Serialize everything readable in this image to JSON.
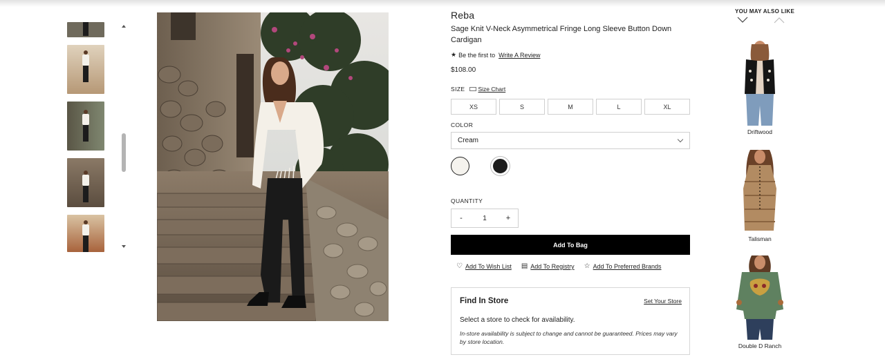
{
  "thumbnails": {
    "items": [
      {
        "label": "thumb-1",
        "bg": "#6f6a5c"
      },
      {
        "label": "thumb-2",
        "bg": "#c9b49a"
      },
      {
        "label": "thumb-3",
        "bg": "#6b7060"
      },
      {
        "label": "thumb-4",
        "bg": "#7a6a58"
      },
      {
        "label": "thumb-5",
        "bg": "#b7805a"
      }
    ]
  },
  "product": {
    "brand": "Reba",
    "name": "Sage Knit V-Neck Asymmetrical Fringe Long Sleeve Button Down Cardigan",
    "review_prefix": "Be the first to",
    "review_link": "Write A Review",
    "price": "$108.00"
  },
  "size": {
    "label": "SIZE",
    "chart_link": "Size Chart",
    "options": [
      "XS",
      "S",
      "M",
      "L",
      "XL"
    ]
  },
  "color": {
    "label": "COLOR",
    "selected": "Cream",
    "swatches": [
      "#f5f3ee",
      "#1d1d1d"
    ]
  },
  "quantity": {
    "label": "QUANTITY",
    "minus": "-",
    "value": "1",
    "plus": "+"
  },
  "actions": {
    "add_to_bag": "Add To Bag",
    "wish_list": "Add To Wish List",
    "registry": "Add To Registry",
    "preferred": "Add To Preferred Brands"
  },
  "store": {
    "title": "Find In Store",
    "set_link": "Set Your Store",
    "message": "Select a store to check for availability.",
    "note": "In-store availability is subject to change and cannot be guaranteed. Prices may vary by store location."
  },
  "recommendations": {
    "title": "YOU MAY ALSO LIKE",
    "items": [
      {
        "name": "Driftwood"
      },
      {
        "name": "Talisman"
      },
      {
        "name": "Double D Ranch"
      }
    ]
  }
}
